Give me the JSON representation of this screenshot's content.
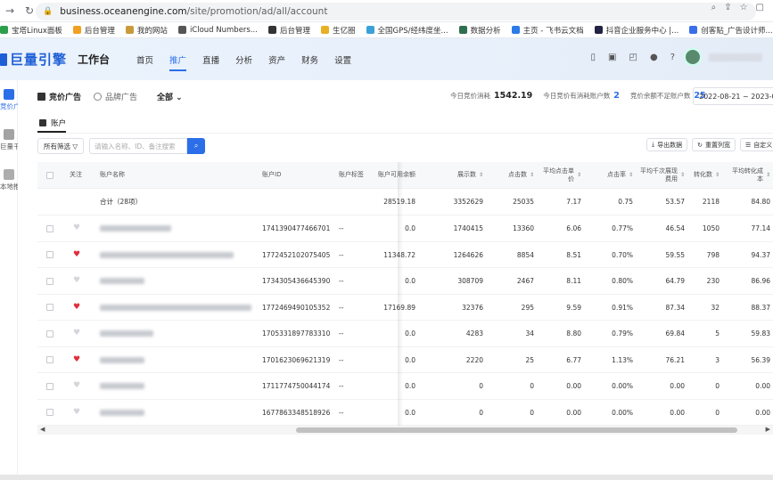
{
  "browser": {
    "url_host": "business.oceanengine.com",
    "url_path": "/site/promotion/ad/all/account",
    "bookmarks": [
      {
        "label": "宝塔Linux面板",
        "color": "#2c9f4b"
      },
      {
        "label": "后台管理",
        "color": "#f0a020"
      },
      {
        "label": "我的网站",
        "color": "#c89a3a"
      },
      {
        "label": "iCloud Numbers...",
        "color": "#555555"
      },
      {
        "label": "后台管理",
        "color": "#333333"
      },
      {
        "label": "生亿圈",
        "color": "#e8b020"
      },
      {
        "label": "全国GPS/经纬度坐...",
        "color": "#3aa0d8"
      },
      {
        "label": "数据分析",
        "color": "#2f6f4f"
      },
      {
        "label": "主页 - 飞书云文档",
        "color": "#2a7be8"
      },
      {
        "label": "抖音企业服务中心 |...",
        "color": "#222244"
      },
      {
        "label": "创客贴_广告设计师...",
        "color": "#3a6ee8"
      },
      {
        "label": "飞书云文档",
        "color": "#3a9ae8"
      }
    ]
  },
  "header": {
    "logo": "巨量引擎",
    "workspace": "工作台",
    "menu": [
      "首页",
      "推广",
      "直播",
      "分析",
      "资产",
      "财务",
      "设置"
    ],
    "active_menu": "推广"
  },
  "sidebar": [
    {
      "label": "竞价广告",
      "active": true
    },
    {
      "label": "巨量千川",
      "active": false
    },
    {
      "label": "本地推",
      "active": false
    }
  ],
  "subtabs": {
    "bidding": "竞价广告",
    "brand": "品牌广告",
    "scope": "全部 ⌄"
  },
  "stats": [
    {
      "label": "今日竞价消耗",
      "value": "1542.19",
      "blue": false
    },
    {
      "label": "今日竞价有消耗账户数",
      "value": "2",
      "blue": true
    },
    {
      "label": "竞价余额不足账户数",
      "value": "25",
      "blue": true
    }
  ],
  "daterange": "2022-08-21 ~ 2023-08-2",
  "account_tab": "账户",
  "toolbar": {
    "filter": "所有筛选 ▽",
    "search_placeholder": "请输入名称、ID、备注搜索",
    "export": "导出数据",
    "reset": "重置列宽",
    "custom": "自定义"
  },
  "table": {
    "headers": [
      "关注",
      "账户名称",
      "账户ID",
      "账户标签",
      "账户可用余额",
      "展示数",
      "点击数",
      "平均点击单价",
      "点击率",
      "平均千次展现费用",
      "转化数",
      "平均转化成本"
    ],
    "total_label": "合计（28项）",
    "total": [
      "28519.18",
      "3352629",
      "25035",
      "7.17",
      "0.75",
      "53.57",
      "2118",
      "84.80"
    ],
    "rows": [
      {
        "fav": false,
        "id": "1741390477466701",
        "tag": "--",
        "vals": [
          "0.0",
          "1740415",
          "13360",
          "6.06",
          "0.77%",
          "46.54",
          "1050",
          "77.14"
        ]
      },
      {
        "fav": true,
        "id": "1772452102075405",
        "tag": "--",
        "vals": [
          "11348.72",
          "1264626",
          "8854",
          "8.51",
          "0.70%",
          "59.55",
          "798",
          "94.37"
        ]
      },
      {
        "fav": false,
        "id": "1734305436645390",
        "tag": "--",
        "vals": [
          "0.0",
          "308709",
          "2467",
          "8.11",
          "0.80%",
          "64.79",
          "230",
          "86.96"
        ]
      },
      {
        "fav": true,
        "id": "1772469490105352",
        "tag": "--",
        "vals": [
          "17169.89",
          "32376",
          "295",
          "9.59",
          "0.91%",
          "87.34",
          "32",
          "88.37"
        ]
      },
      {
        "fav": false,
        "id": "1705331897783310",
        "tag": "--",
        "vals": [
          "0.0",
          "4283",
          "34",
          "8.80",
          "0.79%",
          "69.84",
          "5",
          "59.83"
        ]
      },
      {
        "fav": true,
        "id": "1701623069621319",
        "tag": "--",
        "vals": [
          "0.0",
          "2220",
          "25",
          "6.77",
          "1.13%",
          "76.21",
          "3",
          "56.39"
        ]
      },
      {
        "fav": false,
        "id": "1711774750044174",
        "tag": "--",
        "vals": [
          "0.0",
          "0",
          "0",
          "0.00",
          "0.00%",
          "0.00",
          "0",
          "0.00"
        ]
      },
      {
        "fav": false,
        "id": "1677863348518926",
        "tag": "--",
        "vals": [
          "0.0",
          "0",
          "0",
          "0.00",
          "0.00%",
          "0.00",
          "0",
          "0.00"
        ]
      }
    ]
  },
  "colors": {
    "accent": "#2c6ee8",
    "fav_on": "#e02d3c",
    "fav_off": "#d4d6da"
  }
}
